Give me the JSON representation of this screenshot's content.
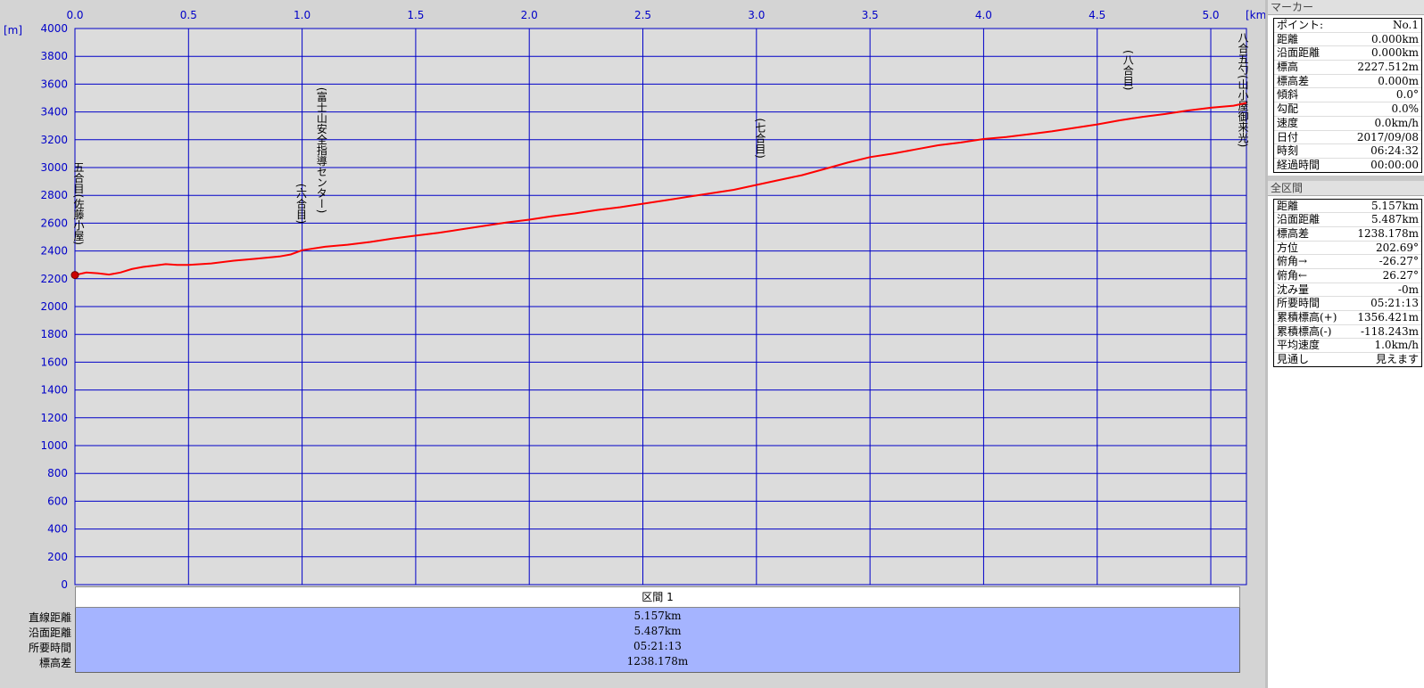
{
  "chart_data": {
    "type": "line",
    "xlabel": "[km]",
    "ylabel": "[m]",
    "xlim": [
      0,
      5.157
    ],
    "ylim": [
      0,
      4000
    ],
    "x_ticks": [
      0.0,
      0.5,
      1.0,
      1.5,
      2.0,
      2.5,
      3.0,
      3.5,
      4.0,
      4.5,
      5.0
    ],
    "x_tick_labels": [
      "0.0",
      "0.5",
      "1.0",
      "1.5",
      "2.0",
      "2.5",
      "3.0",
      "3.5",
      "4.0",
      "4.5",
      "5.0"
    ],
    "y_ticks": [
      0,
      200,
      400,
      600,
      800,
      1000,
      1200,
      1400,
      1600,
      1800,
      2000,
      2200,
      2400,
      2600,
      2800,
      3000,
      3200,
      3400,
      3600,
      3800,
      4000
    ],
    "y_tick_labels": [
      "0",
      "200",
      "400",
      "600",
      "800",
      "1000",
      "1200",
      "1400",
      "1600",
      "1800",
      "2000",
      "2200",
      "2400",
      "2600",
      "2800",
      "3000",
      "3200",
      "3400",
      "3600",
      "3800",
      "4000"
    ],
    "grid": true,
    "line_color": "#ff0000",
    "series": [
      {
        "x": [
          0.0,
          0.05,
          0.1,
          0.15,
          0.2,
          0.25,
          0.3,
          0.35,
          0.4,
          0.45,
          0.5,
          0.6,
          0.7,
          0.8,
          0.9,
          0.95,
          1.0,
          1.1,
          1.2,
          1.3,
          1.4,
          1.5,
          1.6,
          1.7,
          1.8,
          1.9,
          2.0,
          2.1,
          2.2,
          2.3,
          2.4,
          2.5,
          2.6,
          2.7,
          2.8,
          2.9,
          3.0,
          3.1,
          3.2,
          3.3,
          3.4,
          3.5,
          3.6,
          3.7,
          3.8,
          3.9,
          4.0,
          4.1,
          4.2,
          4.3,
          4.4,
          4.5,
          4.6,
          4.7,
          4.8,
          4.9,
          5.0,
          5.1,
          5.157
        ],
        "y": [
          2227,
          2245,
          2240,
          2230,
          2245,
          2270,
          2285,
          2295,
          2305,
          2300,
          2300,
          2310,
          2330,
          2345,
          2360,
          2375,
          2405,
          2430,
          2445,
          2465,
          2490,
          2510,
          2530,
          2555,
          2580,
          2605,
          2625,
          2650,
          2670,
          2695,
          2715,
          2740,
          2765,
          2790,
          2815,
          2840,
          2875,
          2910,
          2945,
          2990,
          3035,
          3075,
          3100,
          3130,
          3160,
          3180,
          3205,
          3220,
          3240,
          3260,
          3285,
          3310,
          3340,
          3365,
          3385,
          3410,
          3430,
          3445,
          3465
        ]
      }
    ],
    "annotations": [
      {
        "x": 0.0,
        "label": "五合目(佐藤小屋)"
      },
      {
        "x": 0.98,
        "label": "(六合目)"
      },
      {
        "x": 1.07,
        "label": "(富士山安全指導センター)"
      },
      {
        "x": 3.0,
        "label": "(七合目)"
      },
      {
        "x": 4.62,
        "label": "(八合目)"
      },
      {
        "x": 5.157,
        "label": "八合五勺(山小屋御来光)"
      }
    ]
  },
  "section": {
    "header": "区間 1",
    "rows": [
      {
        "label": "直線距離",
        "value": "5.157km"
      },
      {
        "label": "沿面距離",
        "value": "5.487km"
      },
      {
        "label": "所要時間",
        "value": "05:21:13"
      },
      {
        "label": "標高差",
        "value": "1238.178m"
      }
    ]
  },
  "marker_panel": {
    "title": "マーカー",
    "rows": [
      {
        "key": "ポイント:",
        "value": "No.1"
      },
      {
        "key": "距離",
        "value": "0.000km"
      },
      {
        "key": "沿面距離",
        "value": "0.000km"
      },
      {
        "key": "標高",
        "value": "2227.512m"
      },
      {
        "key": "標高差",
        "value": "0.000m"
      },
      {
        "key": "傾斜",
        "value": "0.0°"
      },
      {
        "key": "勾配",
        "value": "0.0%"
      },
      {
        "key": "速度",
        "value": "0.0km/h"
      },
      {
        "key": "日付",
        "value": "2017/09/08"
      },
      {
        "key": "時刻",
        "value": "06:24:32"
      },
      {
        "key": "経過時間",
        "value": "00:00:00"
      }
    ]
  },
  "total_panel": {
    "title": "全区間",
    "rows": [
      {
        "key": "距離",
        "value": "5.157km"
      },
      {
        "key": "沿面距離",
        "value": "5.487km"
      },
      {
        "key": "標高差",
        "value": "1238.178m"
      },
      {
        "key": "方位",
        "value": "202.69°"
      },
      {
        "key": "俯角→",
        "value": "-26.27°"
      },
      {
        "key": "俯角←",
        "value": "26.27°"
      },
      {
        "key": "沈み量",
        "value": "-0m"
      },
      {
        "key": "所要時間",
        "value": "05:21:13"
      },
      {
        "key": "累積標高(+)",
        "value": "1356.421m"
      },
      {
        "key": "累積標高(-)",
        "value": "-118.243m"
      },
      {
        "key": "平均速度",
        "value": "1.0km/h"
      },
      {
        "key": "見通し",
        "value": "見えます"
      }
    ]
  }
}
